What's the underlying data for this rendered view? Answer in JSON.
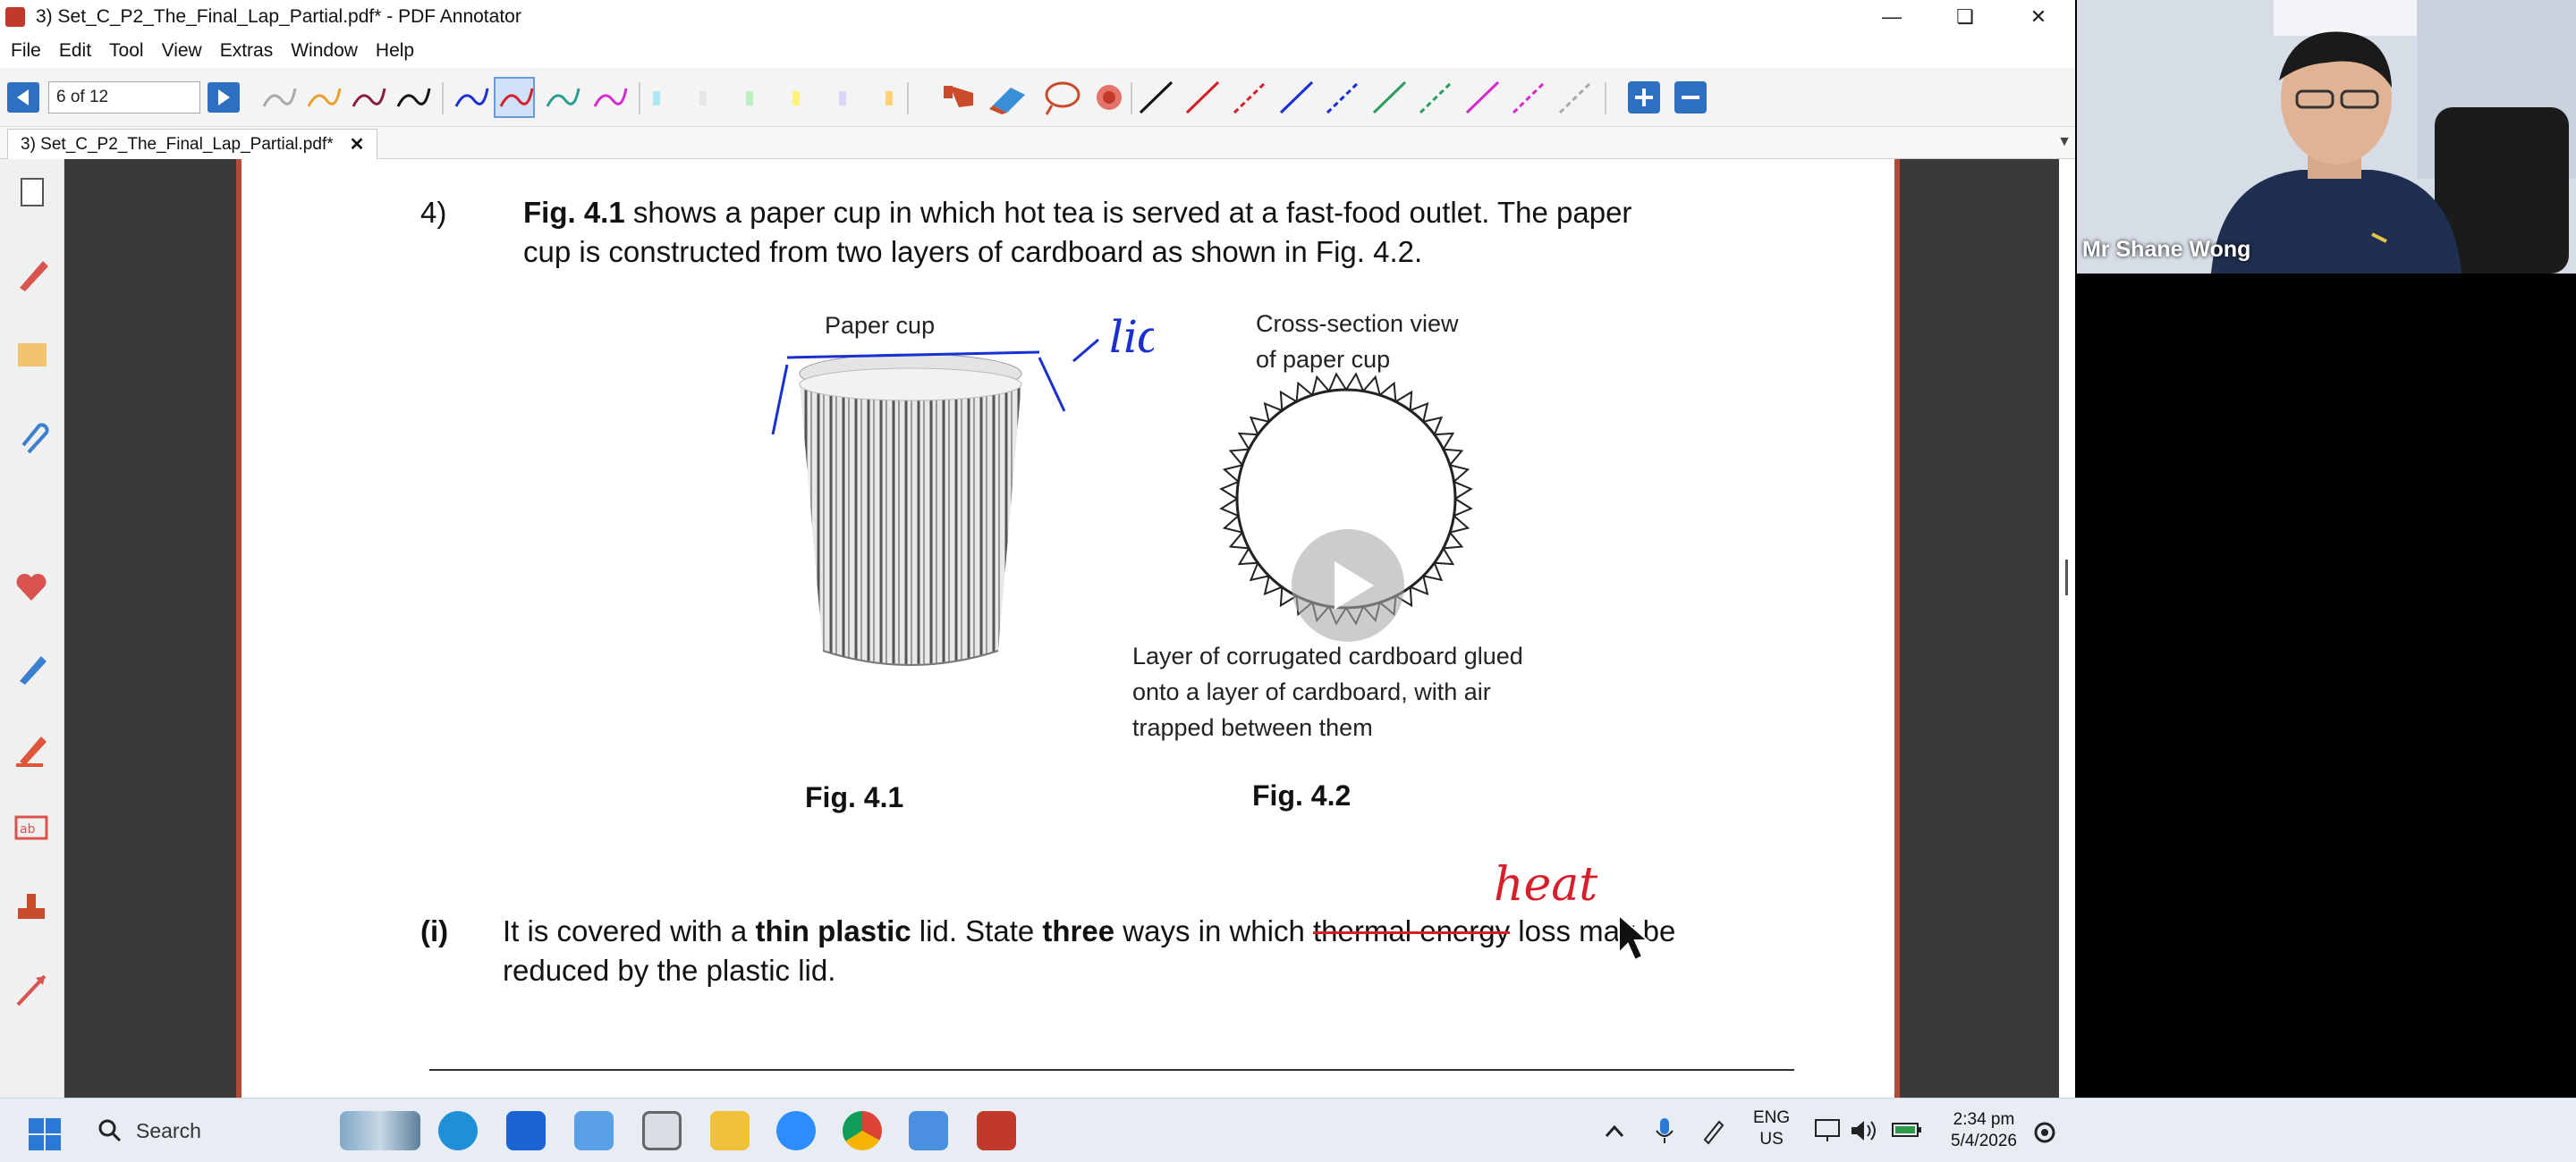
{
  "window": {
    "title": "3) Set_C_P2_The_Final_Lap_Partial.pdf* - PDF Annotator",
    "minimize_icon": "minimize-icon",
    "maximize_icon": "maximize-icon",
    "close_icon": "close-icon"
  },
  "menu": [
    "File",
    "Edit",
    "Tool",
    "View",
    "Extras",
    "Window",
    "Help"
  ],
  "toolbar": {
    "page_value": "6 of 12",
    "prev_icon": "prev-page-icon",
    "next_icon": "next-page-icon"
  },
  "tab": {
    "label": "3) Set_C_P2_The_Final_Lap_Partial.pdf*",
    "close": "✕"
  },
  "document": {
    "q_number": "4)",
    "intro_bold": "Fig. 4.1",
    "intro_rest_1": " shows a paper cup in which hot tea is served at a fast-food outlet. The paper",
    "intro_line_2": "cup is constructed from two layers of cardboard as shown in Fig. 4.2.",
    "paper_cup_caption": "Paper cup",
    "cross_section_caption_1": "Cross-section view",
    "cross_section_caption_2": "of paper cup",
    "layer_caption_1": "Layer of corrugated cardboard glued",
    "layer_caption_2": "onto a layer of cardboard, with air",
    "layer_caption_3": "trapped between them",
    "fig1_label": "Fig. 4.1",
    "fig2_label": "Fig. 4.2",
    "sub_number": "(i)",
    "sub_t1": "It is covered with a ",
    "sub_b1": "thin plastic",
    "sub_t2": " lid. State ",
    "sub_b2": "three",
    "sub_t3": " ways in which ",
    "sub_strike": "thermal energy",
    "sub_t4": " loss may be",
    "sub_line_2": "reduced by the plastic lid.",
    "annotation_lid": "lid",
    "annotation_heat": "heat"
  },
  "camera": {
    "name": "Mr Shane Wong"
  },
  "taskbar": {
    "search_label": "Search",
    "lang_1": "ENG",
    "lang_2": "US",
    "time": "2:34 pm",
    "date": "5/4/2026"
  },
  "colors": {
    "accent_blue": "#2d6fc1",
    "page_border": "#b24a3a",
    "annotation_blue": "#1a2fd0",
    "annotation_red": "#d61f2a"
  }
}
